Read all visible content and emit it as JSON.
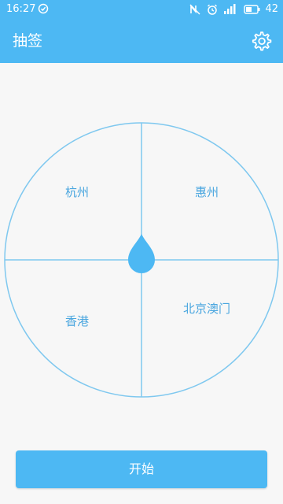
{
  "status_bar": {
    "time": "16:27",
    "battery_level": "42",
    "icons": [
      "check-circle-icon",
      "nfc-off-icon",
      "alarm-clock-icon",
      "signal-icon",
      "battery-icon"
    ]
  },
  "app_bar": {
    "title": "抽签",
    "settings_icon": "gear-icon"
  },
  "wheel": {
    "sectors": [
      {
        "label": "杭州"
      },
      {
        "label": "惠州"
      },
      {
        "label": "香港"
      },
      {
        "label": "北京澳门"
      }
    ],
    "pointer_icon": "droplet-pointer-icon"
  },
  "start_button": {
    "label": "开始"
  },
  "colors": {
    "primary": "#4db8f3",
    "wheel_line": "#7fc8ef",
    "label": "#4aa6df",
    "background": "#f7f7f7"
  }
}
